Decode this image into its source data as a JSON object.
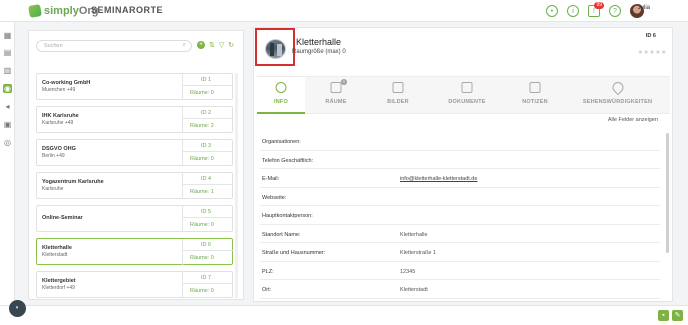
{
  "header": {
    "logo_simply": "simply",
    "logo_org": "Org",
    "title": "SEMINARORTE",
    "notification_count": "99",
    "user_name": "Julia"
  },
  "list": {
    "search_placeholder": "Suchen",
    "items": [
      {
        "name": "Co-working GmbH",
        "sub": "Muenchen +49",
        "id": "ID 1",
        "rooms": "Räume: 0"
      },
      {
        "name": "IHK Karlsruhe",
        "sub": "Karlsruhe +49",
        "id": "ID 2",
        "rooms": "Räume: 2"
      },
      {
        "name": "DSGVO OHG",
        "sub": "Berlin +49",
        "id": "ID 3",
        "rooms": "Räume: 0"
      },
      {
        "name": "Yogazentrum Karlsruhe",
        "sub": "Karlsruhe",
        "id": "ID 4",
        "rooms": "Räume: 1"
      },
      {
        "name": "Online-Seminar",
        "sub": "",
        "id": "ID 5",
        "rooms": "Räume: 0"
      },
      {
        "name": "Kletterhalle",
        "sub": "Kletterstadt",
        "id": "ID 6",
        "rooms": "Räume: 0"
      },
      {
        "name": "Klettergebiet",
        "sub": "Kletterdorf +49",
        "id": "ID 7",
        "rooms": "Räume: 0"
      }
    ]
  },
  "detail": {
    "title": "Kletterhalle",
    "subtitle": "Raumgröße (max) 0",
    "id": "ID 6",
    "stars": "★★★★★",
    "show_all": "Alle Felder anzeigen",
    "tabs": [
      {
        "label": "INFO"
      },
      {
        "label": "RÄUME",
        "badge": "0"
      },
      {
        "label": "BILDER"
      },
      {
        "label": "DOKUMENTE"
      },
      {
        "label": "NOTIZEN"
      },
      {
        "label": "SEHENSWÜRDIGKEITEN"
      }
    ],
    "fields": [
      {
        "label": "Organisationen:",
        "value": ""
      },
      {
        "label": "Telefon Geschäftlich:",
        "value": ""
      },
      {
        "label": "E-Mail:",
        "value": "info@kletterhalle-kletterstadt.de"
      },
      {
        "label": "Webseite:",
        "value": ""
      },
      {
        "label": "Hauptkontaktperson:",
        "value": ""
      },
      {
        "label": "Standort Name:",
        "value": "Kletterhalle"
      },
      {
        "label": "Straße und Hausnummer:",
        "value": "Kletterstraße 1"
      },
      {
        "label": "PLZ:",
        "value": "12345"
      },
      {
        "label": "Ort:",
        "value": "Kletterstadt"
      }
    ]
  },
  "accent": "#7cb342"
}
